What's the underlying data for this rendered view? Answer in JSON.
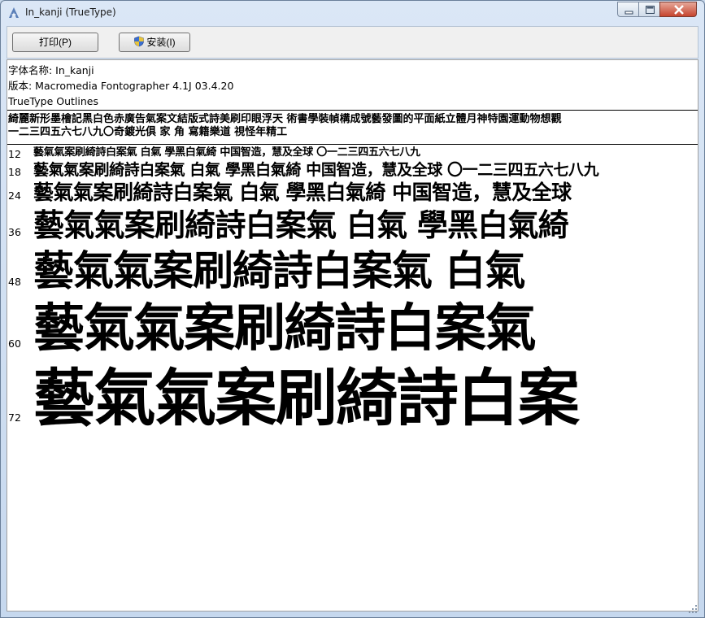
{
  "window": {
    "title": "In_kanji (TrueType)"
  },
  "toolbar": {
    "print_label": "打印(P)",
    "install_label": "安装(I)"
  },
  "font_info": {
    "name_line": "字体名称: In_kanji",
    "version_line": "版本: Macromedia Fontographer 4.1J 03.4.20",
    "type_line": "TrueType Outlines"
  },
  "charset": {
    "line1": "綺麗新形墨檜記黑白色赤廣告氣案文結版式詩美刷印眼浮天 術書學裝幀構成號藝發圖的平面紙立體月神特園運動物想觀",
    "line2": "一二三四五六七八九〇奇鍍光俱 家 角 寫籍樂道 視怪年精工"
  },
  "samples": [
    {
      "size": "12",
      "text": "藝氣氣案刷綺詩白案氣 白氣 學黑白氣綺 中国智造，慧及全球 〇一二三四五六七八九"
    },
    {
      "size": "18",
      "text": "藝氣氣案刷綺詩白案氣 白氣 學黑白氣綺 中国智造，慧及全球 〇一二三四五六七八九"
    },
    {
      "size": "24",
      "text": "藝氣氣案刷綺詩白案氣 白氣 學黑白氣綺 中国智造，慧及全球"
    },
    {
      "size": "36",
      "text": "藝氣氣案刷綺詩白案氣 白氣 學黑白氣綺"
    },
    {
      "size": "48",
      "text": "藝氣氣案刷綺詩白案氣 白氣"
    },
    {
      "size": "60",
      "text": "藝氣氣案刷綺詩白案氣"
    },
    {
      "size": "72",
      "text": "藝氣氣案刷綺詩白案"
    }
  ]
}
